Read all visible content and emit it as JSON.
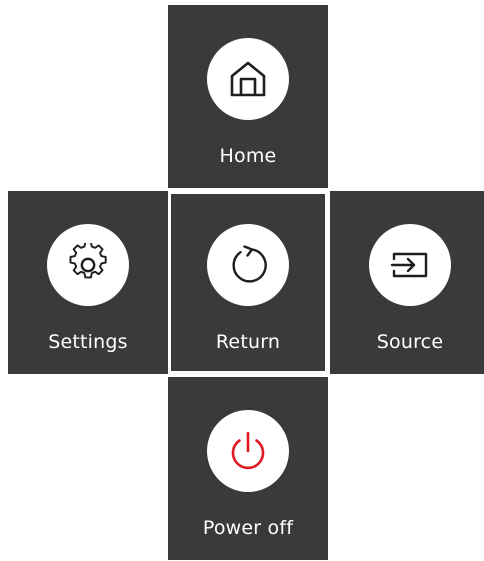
{
  "menu": {
    "home": {
      "label": "Home",
      "icon": "home-icon"
    },
    "settings": {
      "label": "Settings",
      "icon": "gear-icon"
    },
    "return": {
      "label": "Return",
      "icon": "return-icon",
      "selected": true
    },
    "source": {
      "label": "Source",
      "icon": "source-input-icon"
    },
    "power": {
      "label": "Power off",
      "icon": "power-icon"
    }
  },
  "colors": {
    "tile_background": "#3a3a3a",
    "circle_background": "#ffffff",
    "icon_stroke": "#1e1e1e",
    "power_icon": "#e01a22",
    "label_text": "#ffffff",
    "selected_border": "#ffffff"
  }
}
